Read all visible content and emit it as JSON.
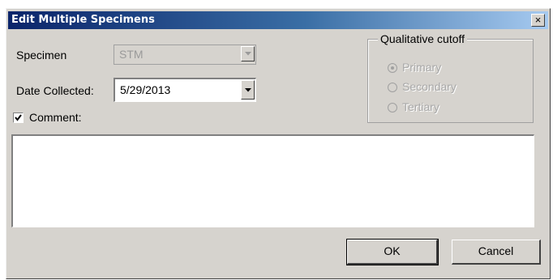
{
  "window": {
    "title": "Edit Multiple Specimens",
    "close_glyph": "×"
  },
  "specimen": {
    "label": "Specimen",
    "value": "STM",
    "enabled": false
  },
  "date_collected": {
    "label": "Date Collected:",
    "value": "5/29/2013"
  },
  "comment": {
    "label": "Comment:",
    "checked": true,
    "text": ""
  },
  "qualitative_cutoff": {
    "title": "Qualitative cutoff",
    "options": [
      {
        "label": "Primary",
        "selected": true,
        "enabled": false
      },
      {
        "label": "Secondary",
        "selected": false,
        "enabled": false
      },
      {
        "label": "Tertiary",
        "selected": false,
        "enabled": false
      }
    ]
  },
  "buttons": {
    "ok": "OK",
    "cancel": "Cancel"
  }
}
